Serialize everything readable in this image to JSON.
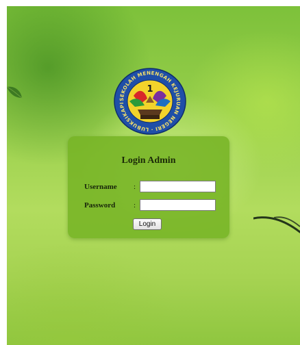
{
  "login": {
    "title": "Login Admin",
    "username_label": "Username",
    "password_label": "Password",
    "separator": ":",
    "username_value": "",
    "password_value": "",
    "button_label": "Login"
  },
  "logo": {
    "number": "1",
    "ring_text": "SEKOLAH MENENGAH KEJURUAN NEGERI · LUBUKSIKAPING ·"
  },
  "colors": {
    "panel": "#76b426",
    "background": "#9ad04d",
    "logo_ring": "#1f4fa8",
    "logo_inner": "#f2d32b"
  }
}
